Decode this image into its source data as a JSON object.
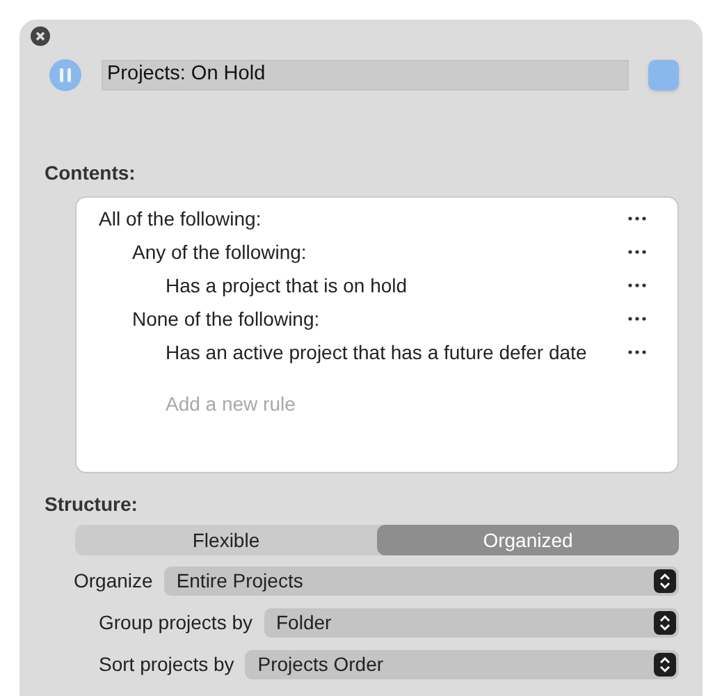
{
  "perspective": {
    "title": "Projects: On Hold",
    "color": "#8ab8ec"
  },
  "contents": {
    "label": "Contents:",
    "rules": [
      {
        "text": "All of the following:",
        "children": [
          {
            "text": "Any of the following:",
            "children": [
              {
                "text": "Has a project that is on hold"
              }
            ]
          },
          {
            "text": "None of the following:",
            "children": [
              {
                "text": "Has an active project that has a future defer date"
              }
            ]
          }
        ]
      }
    ],
    "add_rule": {
      "placeholder": "Add a new rule"
    }
  },
  "structure": {
    "label": "Structure:",
    "segments": [
      {
        "label": "Flexible",
        "selected": false
      },
      {
        "label": "Organized",
        "selected": true
      }
    ],
    "popups": [
      {
        "label": "Organize",
        "value": "Entire Projects",
        "children": [
          {
            "label": "Group projects by",
            "value": "Folder"
          },
          {
            "label": "Sort projects by",
            "value": "Projects Order"
          }
        ]
      }
    ]
  }
}
